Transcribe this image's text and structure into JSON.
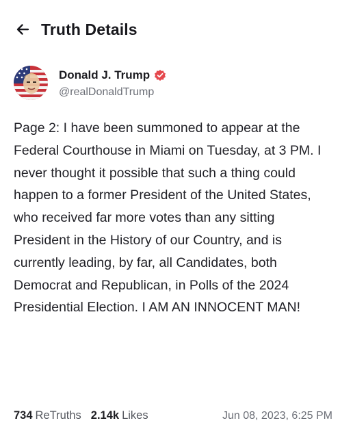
{
  "header": {
    "back_icon": "arrow-left-icon",
    "title": "Truth Details"
  },
  "author": {
    "display_name": "Donald J. Trump",
    "verified_icon": "verified-check-icon",
    "verified_color": "#e5484d",
    "handle": "@realDonaldTrump"
  },
  "post": {
    "text": "Page 2: I have been summoned to appear at the Federal Courthouse in Miami on Tuesday, at 3 PM. I never thought it possible that such a thing could happen to a former President of the United States, who received far more votes than any sitting President in the History of our Country, and is currently leading, by far, all Candidates, both Democrat and Republican, in Polls of the 2024 Presidential Election. I AM AN INNOCENT MAN!"
  },
  "stats": {
    "retruths_count": "734",
    "retruths_label": "ReTruths",
    "likes_count": "2.14k",
    "likes_label": "Likes",
    "timestamp": "Jun 08, 2023, 6:25 PM"
  }
}
